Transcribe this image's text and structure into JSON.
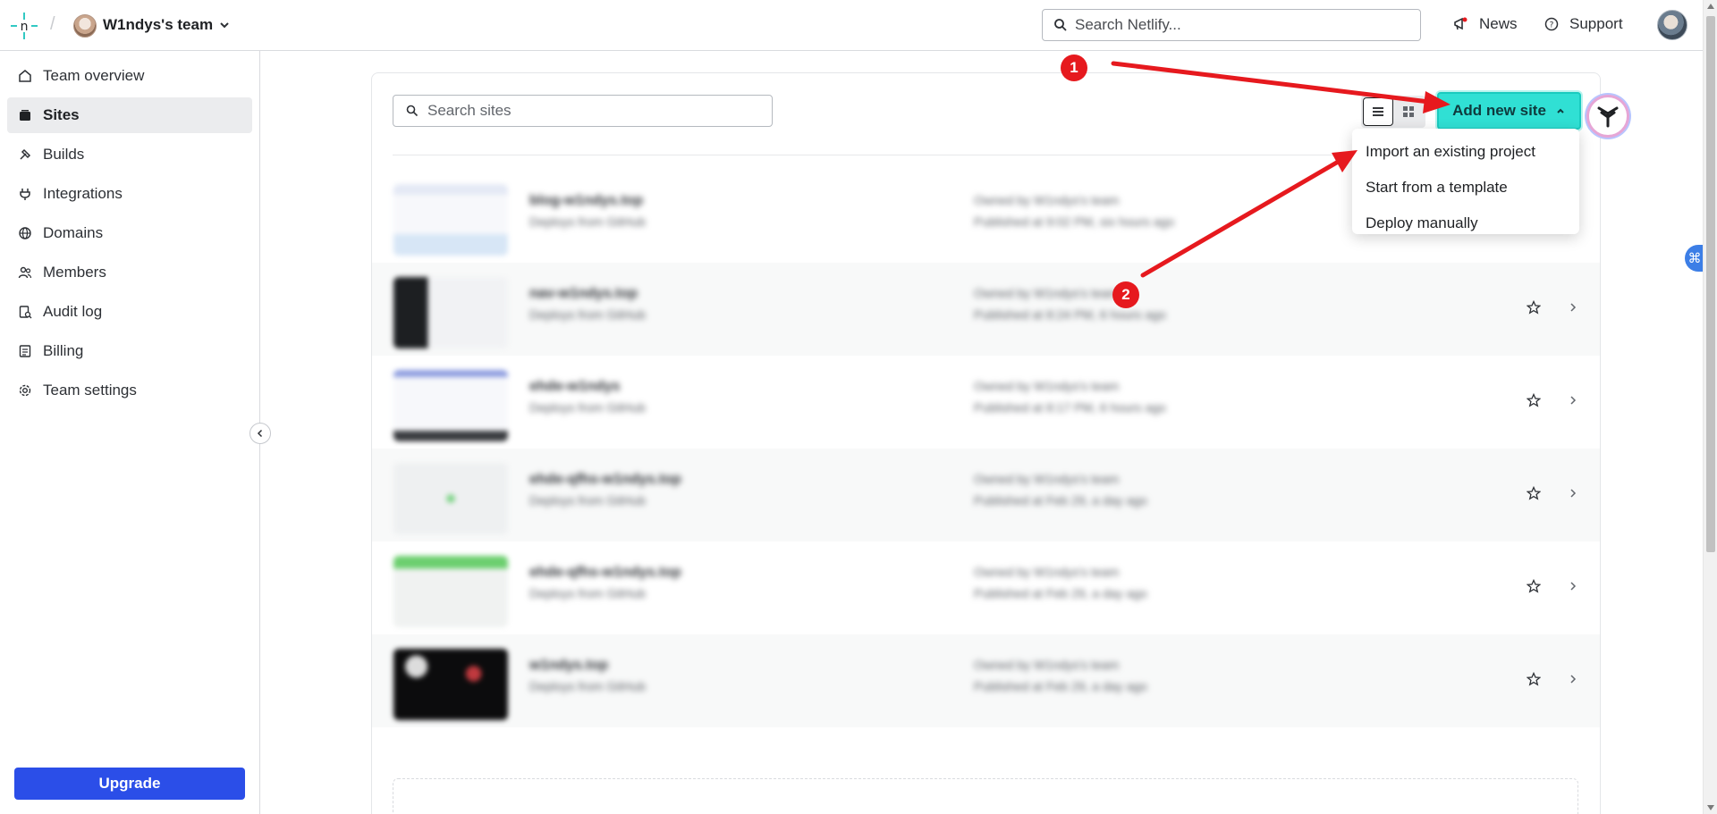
{
  "header": {
    "team_name": "W1ndys's team",
    "search_placeholder": "Search Netlify...",
    "news_label": "News",
    "support_label": "Support"
  },
  "sidebar": {
    "items": [
      {
        "label": "Team overview",
        "icon": "home-icon"
      },
      {
        "label": "Sites",
        "icon": "layers-icon"
      },
      {
        "label": "Builds",
        "icon": "hammer-icon"
      },
      {
        "label": "Integrations",
        "icon": "plug-icon"
      },
      {
        "label": "Domains",
        "icon": "globe-icon"
      },
      {
        "label": "Members",
        "icon": "users-icon"
      },
      {
        "label": "Audit log",
        "icon": "audit-log-icon"
      },
      {
        "label": "Billing",
        "icon": "billing-icon"
      },
      {
        "label": "Team settings",
        "icon": "gear-icon"
      }
    ],
    "upgrade_label": "Upgrade"
  },
  "main": {
    "search_placeholder": "Search sites",
    "add_site_label": "Add new site",
    "dropdown": [
      "Import an existing project",
      "Start from a template",
      "Deploy manually"
    ],
    "sites": [
      {
        "name": "blog-w1ndys.top",
        "sub": "Deploys from GitHub",
        "owner": "Owned by W1ndys's team",
        "published": "Published at 9:02 PM, six hours ago"
      },
      {
        "name": "nav-w1ndys.top",
        "sub": "Deploys from GitHub",
        "owner": "Owned by W1ndys's team",
        "published": "Published at 8:24 PM, 6 hours ago"
      },
      {
        "name": "ehde-w1ndys",
        "sub": "Deploys from GitHub",
        "owner": "Owned by W1ndys's team",
        "published": "Published at 8:17 PM, 6 hours ago"
      },
      {
        "name": "ehde-qfhs-w1ndys.top",
        "sub": "Deploys from GitHub",
        "owner": "Owned by W1ndys's team",
        "published": "Published at Feb 29, a day ago"
      },
      {
        "name": "ehde-qfhs-w1ndys.top",
        "sub": "Deploys from GitHub",
        "owner": "Owned by W1ndys's team",
        "published": "Published at Feb 29, a day ago"
      },
      {
        "name": "w1ndys.top",
        "sub": "Deploys from GitHub",
        "owner": "Owned by W1ndys's team",
        "published": "Published at Feb 29, a day ago"
      }
    ]
  },
  "annotations": {
    "badge_1": "1",
    "badge_2": "2"
  },
  "colors": {
    "accent": "#30e0d4",
    "upgrade": "#2b4ee8",
    "annotation": "#e6191e"
  }
}
